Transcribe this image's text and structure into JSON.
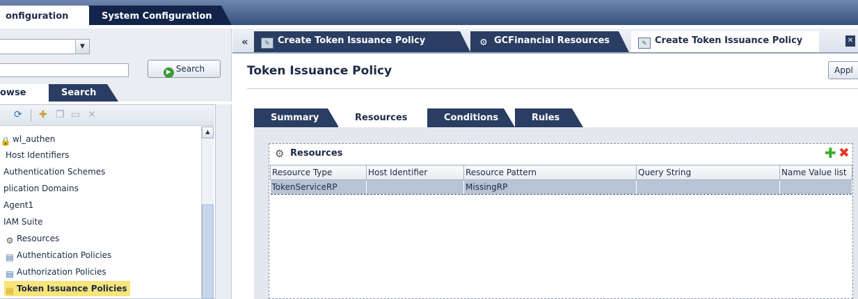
{
  "top_tabs": {
    "active_label": "onfiguration",
    "system_label": "System Configuration"
  },
  "left": {
    "search_button": "Search",
    "tabs": {
      "browse": "owse",
      "search": "Search"
    },
    "tree": {
      "items": [
        {
          "label": "wl_authen",
          "icon": "lock-icon"
        },
        {
          "label": "Host Identifiers",
          "icon": ""
        },
        {
          "label": "Authentication Schemes",
          "icon": ""
        },
        {
          "label": "plication Domains",
          "icon": ""
        },
        {
          "label": "Agent1",
          "icon": ""
        },
        {
          "label": "IAM Suite",
          "icon": ""
        },
        {
          "label": "Resources",
          "icon": "resources-gear-icon"
        },
        {
          "label": "Authentication Policies",
          "icon": "authentication-policy-icon"
        },
        {
          "label": "Authorization Policies",
          "icon": "authorization-policy-icon"
        },
        {
          "label": "Token Issuance Policies",
          "icon": "token-issuance-policy-icon"
        }
      ]
    }
  },
  "right": {
    "tabs": [
      {
        "label": "Create Token Issuance Policy"
      },
      {
        "label": "GCFinancial Resources"
      },
      {
        "label": "Create Token Issuance Policy"
      }
    ],
    "page_title": "Token Issuance Policy",
    "apply_button": "Appl",
    "sub_tabs": [
      "Summary",
      "Resources",
      "Conditions",
      "Rules"
    ],
    "resources": {
      "title": "Resources",
      "columns": [
        "Resource Type",
        "Host Identifier",
        "Resource Pattern",
        "Query String",
        "Name Value list"
      ],
      "rows": [
        [
          "TokenServiceRP",
          "",
          "MissingRP",
          "",
          ""
        ]
      ]
    }
  },
  "colors": {
    "nav_dark": "#2a3d62",
    "selected_tree": "#f8e57b",
    "selected_row": "#b9c3d6",
    "add_green": "#3bab2c",
    "delete_red": "#e23b2e"
  }
}
